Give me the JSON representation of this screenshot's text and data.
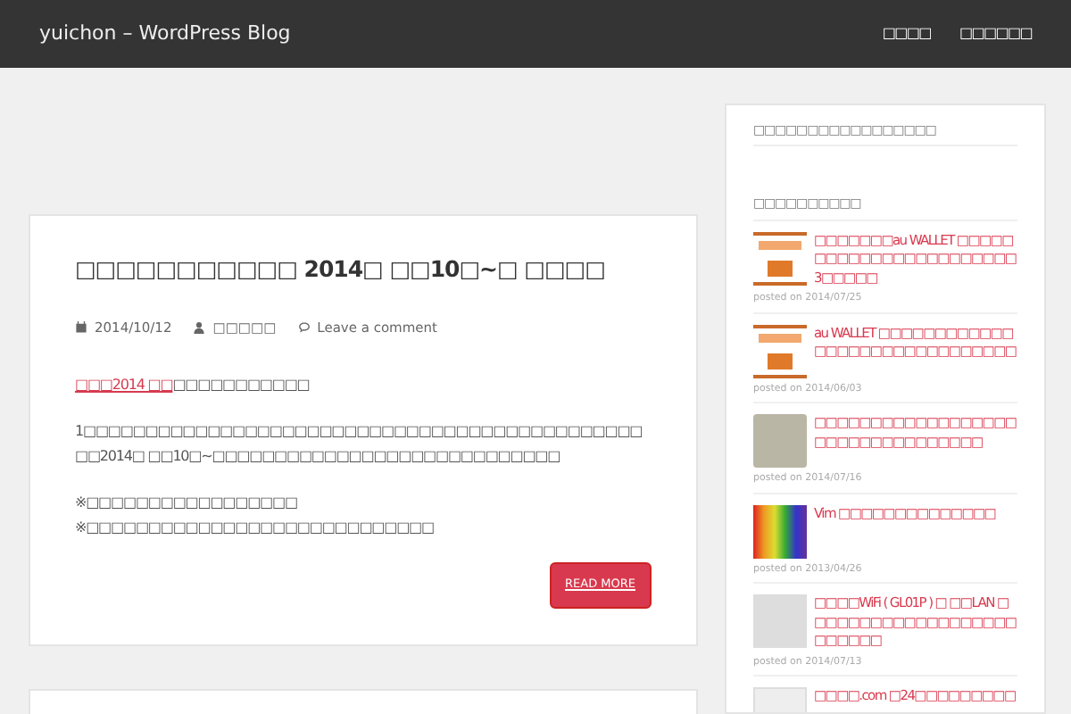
{
  "navbar": {
    "brand": "yuichon – WordPress Blog",
    "items": [
      "□□□□",
      "□□□□□□"
    ]
  },
  "posts": [
    {
      "title": "□□□□□□□□□□□ 2014□ □□10□~□ □□□□",
      "date": "2014/10/12",
      "author": "□□□□□",
      "comment_link": "Leave a comment",
      "lead_link": "□□□2014 □□",
      "lead_rest": "□□□□□□□□□□□",
      "paragraph": "1□□□□□□□□□□□□□□□□□□□□□□□□□□□□□□□□□□□□□□□□□□□□□□□2014□ □□10□~□□□□□□□□□□□□□□□□□□□□□□□□□□□□",
      "notes": [
        "※□□□□□□□□□□□□□□□□□",
        "※□□□□□□□□□□□□□□□□□□□□□□□□□□□□"
      ],
      "button": "READ MORE"
    }
  ],
  "sidebar": {
    "widgets": [
      {
        "title": "□□□□□□□□□□□□□□□□□"
      },
      {
        "title": "□□□□□□□□□□",
        "items": [
          {
            "title": "□□□□□□□au WALLET □□□□□□□□□□□□□□□□□□□□□□□3□□□□□",
            "date": "posted on 2014/07/25"
          },
          {
            "title": "au WALLET □□□□□□□□□□□□□□□□□□□□□□□□□□□□□□",
            "date": "posted on 2014/06/03"
          },
          {
            "title": "□□□□□□□□□□□□□□□□□□□□□□□□□□□□□□□□□",
            "date": "posted on 2014/07/16"
          },
          {
            "title": "Vim □□□□□□□□□□□□□□",
            "date": "posted on 2013/04/26"
          },
          {
            "title": "□□□□WiFi ( GL01P ) □ □□LAN □□□□□□□□□□□□□□□□□□□□□□□□□",
            "date": "posted on 2014/07/13"
          },
          {
            "title": "□□□□.com □24□□□□□□□□□"
          }
        ]
      }
    ]
  }
}
